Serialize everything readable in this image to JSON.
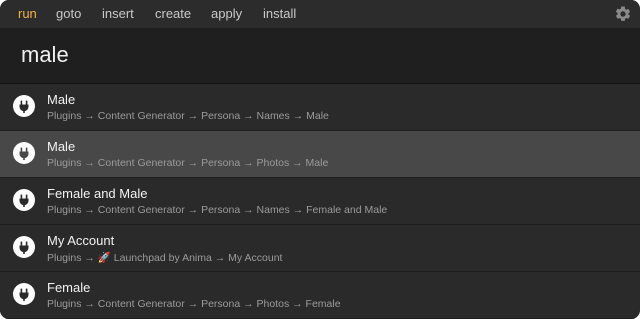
{
  "tabs": [
    {
      "label": "run",
      "active": true
    },
    {
      "label": "goto",
      "active": false
    },
    {
      "label": "insert",
      "active": false
    },
    {
      "label": "create",
      "active": false
    },
    {
      "label": "apply",
      "active": false
    },
    {
      "label": "install",
      "active": false
    }
  ],
  "settings_icon": "gear-icon",
  "search": {
    "value": "male",
    "placeholder": ""
  },
  "results": [
    {
      "title": "Male",
      "path": "Plugins → Content Generator → Persona → Names → Male",
      "icon": "plugin-icon",
      "selected": false
    },
    {
      "title": "Male",
      "path": "Plugins → Content Generator → Persona → Photos → Male",
      "icon": "plugin-icon",
      "selected": true
    },
    {
      "title": "Female and Male",
      "path": "Plugins → Content Generator → Persona → Names → Female and Male",
      "icon": "plugin-icon",
      "selected": false
    },
    {
      "title": "My Account",
      "path": "Plugins → 🚀 Launchpad by Anima → My Account",
      "icon": "plugin-icon",
      "selected": false
    },
    {
      "title": "Female",
      "path": "Plugins → Content Generator → Persona → Photos → Female",
      "icon": "plugin-icon",
      "selected": false
    }
  ],
  "colors": {
    "active_tab": "#f2b441",
    "selected_row": "#484848",
    "background": "#262626"
  }
}
